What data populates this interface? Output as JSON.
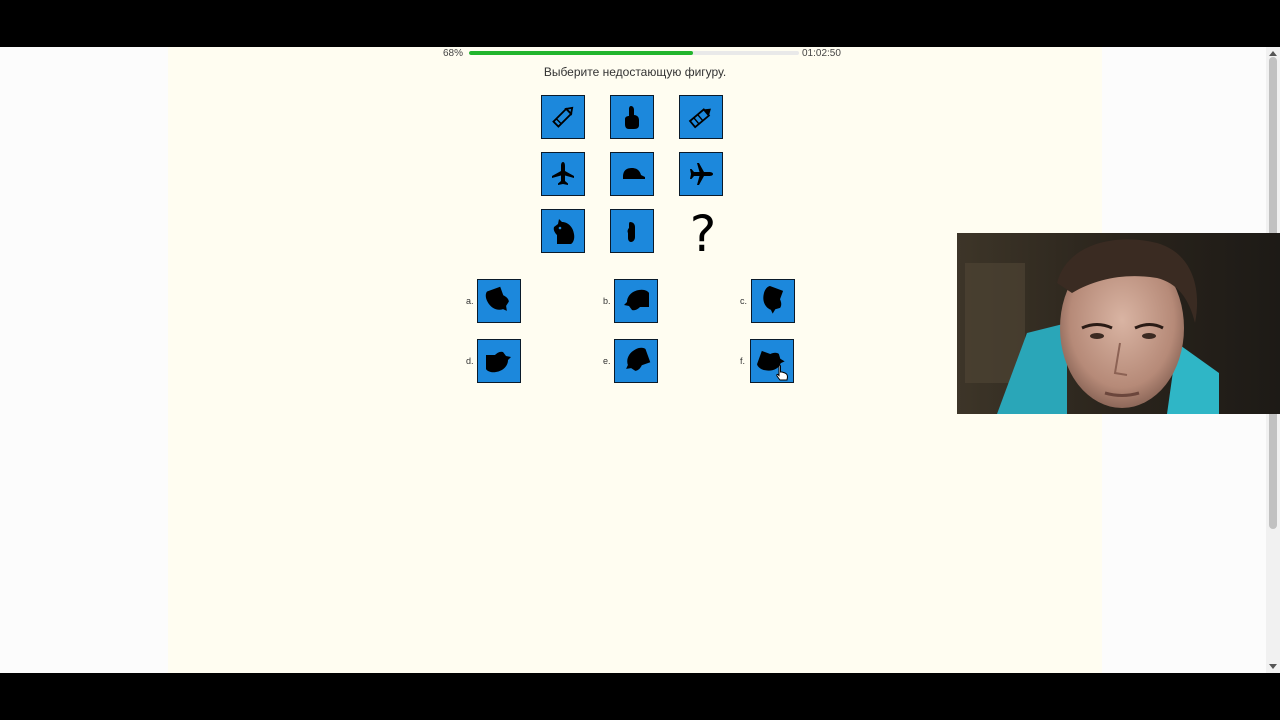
{
  "progress": {
    "percent_label": "68%",
    "fraction": 0.68,
    "timer": "01:02:50",
    "bar_color": "#22b52d"
  },
  "question": {
    "text": "Выберите недостающую фигуру."
  },
  "colors": {
    "tile_bg": "#1c88dc",
    "page_bg": "#fffdf1"
  },
  "matrix": {
    "cells": [
      {
        "icon": "pencil-icon"
      },
      {
        "icon": "pointing-hand-icon"
      },
      {
        "icon": "pencil-tilted-icon"
      },
      {
        "icon": "airplane-icon"
      },
      {
        "icon": "cap-icon"
      },
      {
        "icon": "airplane-right-icon"
      },
      {
        "icon": "horse-head-icon"
      },
      {
        "icon": "hand-fragment-icon"
      },
      {
        "icon": "missing-question-mark"
      }
    ],
    "missing_symbol": "?"
  },
  "options": [
    {
      "label": "a.",
      "icon": "horse-head-rotated-down-icon"
    },
    {
      "label": "b.",
      "icon": "horse-head-left-icon"
    },
    {
      "label": "c.",
      "icon": "horse-head-rotated-down-alt-icon"
    },
    {
      "label": "d.",
      "icon": "horse-head-right-icon"
    },
    {
      "label": "e.",
      "icon": "horse-head-left-alt-icon"
    },
    {
      "label": "f.",
      "icon": "horse-head-right-alt-icon"
    }
  ],
  "webcam": {
    "icon": "webcam-overlay"
  }
}
